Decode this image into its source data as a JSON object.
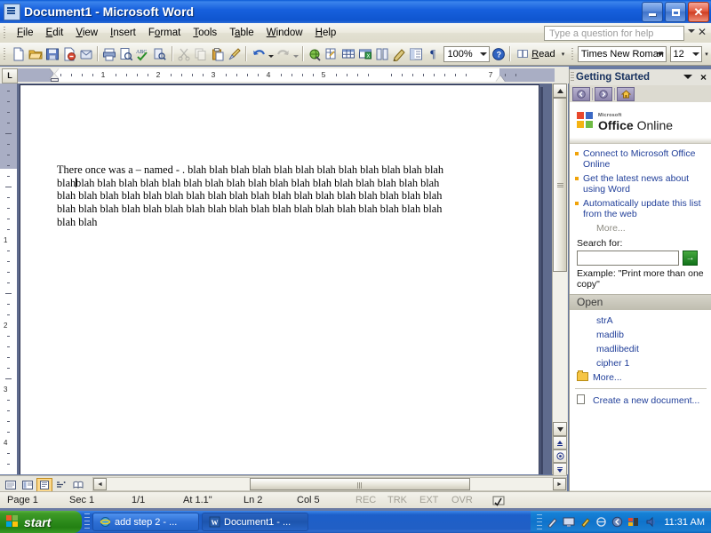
{
  "window": {
    "title": "Document1 - Microsoft Word",
    "app_icon": "word-document-icon",
    "minimize_label": "Minimize",
    "restore_label": "Restore",
    "close_label": "Close"
  },
  "menubar": {
    "items": [
      {
        "label": "File",
        "accel": "F"
      },
      {
        "label": "Edit",
        "accel": "E"
      },
      {
        "label": "View",
        "accel": "V"
      },
      {
        "label": "Insert",
        "accel": "I"
      },
      {
        "label": "Format",
        "accel": "o"
      },
      {
        "label": "Tools",
        "accel": "T"
      },
      {
        "label": "Table",
        "accel": "a"
      },
      {
        "label": "Window",
        "accel": "W"
      },
      {
        "label": "Help",
        "accel": "H"
      }
    ],
    "ask_placeholder": "Type a question for help"
  },
  "toolbar": {
    "buttons": [
      "new-document-icon",
      "open-folder-icon",
      "save-icon",
      "permission-icon",
      "email-icon",
      "print-icon",
      "print-preview-icon",
      "spelling-check-icon",
      "research-icon",
      "cut-icon",
      "copy-icon",
      "paste-icon",
      "format-painter-icon",
      "undo-icon",
      "redo-icon",
      "insert-hyperlink-icon",
      "tables-borders-icon",
      "insert-table-icon",
      "insert-excel-sheet-icon",
      "columns-icon",
      "drawing-icon",
      "document-map-icon",
      "show-hide-paragraph-icon"
    ],
    "zoom_value": "100%",
    "help_icon": "help-icon",
    "read_label": "Read",
    "read_icon": "read-layout-icon",
    "font_name": "Times New Roman",
    "font_size": "12",
    "overflow_label": "Toolbar Options"
  },
  "ruler": {
    "tab_selector": "L",
    "horizontal_numbers": [
      "1",
      "2",
      "3",
      "4",
      "5",
      "7"
    ],
    "vertical_numbers": [
      "1",
      "2",
      "3",
      "4"
    ]
  },
  "document": {
    "paragraph": "There once was a – named - . blah blah blah blah blah blah blah blah blah blah blah blah blah blah blah blah blah blah blah blah blah blah blah blah blah blah blah blah blah blah blah blah blah blah blah blah blah blah blah blah blah blah blah blah blah blah blah blah blah blah blah blah blah blah blah blah blah blah blah blah blah blah blah blah blah blah blah blah",
    "text_before_caret": "There once was a – named - . blah blah blah blah blah blah blah blah blah blah blah blah blah",
    "text_after_caret": "blah blah blah blah blah blah blah blah blah blah blah blah blah blah blah blah blah blah blah blah blah blah blah blah blah blah blah blah blah blah blah blah blah blah blah blah blah blah blah blah blah blah blah blah blah blah blah blah blah blah blah blah blah blah blah"
  },
  "doc_scroll": {
    "up_arrow": "▲",
    "down_arrow": "▼",
    "select_browse_object": "select-browse-object-icon",
    "prev_page": "previous-page-icon",
    "next_page": "next-page-icon",
    "left_arrow": "◄",
    "right_arrow": "►"
  },
  "view_buttons": [
    {
      "name": "normal-view",
      "glyph": "▤",
      "active": false
    },
    {
      "name": "web-layout-view",
      "glyph": "▦",
      "active": false
    },
    {
      "name": "print-layout-view",
      "glyph": "▣",
      "active": true
    },
    {
      "name": "outline-view",
      "glyph": "▥",
      "active": false
    },
    {
      "name": "reading-layout-view",
      "glyph": "▧",
      "active": false
    },
    {
      "name": "scroll-left",
      "glyph": "‹",
      "active": false
    }
  ],
  "taskpane": {
    "title": "Getting Started",
    "close_label": "×",
    "nav": {
      "back": "back-icon",
      "forward": "forward-icon",
      "home": "home-icon"
    },
    "logo": {
      "ms": "Microsoft",
      "office": "Office",
      "online": "Online"
    },
    "links": [
      "Connect to Microsoft Office Online",
      "Get the latest news about using Word",
      "Automatically update this list from the web"
    ],
    "more_label": "More...",
    "search_label": "Search for:",
    "search_value": "",
    "go_label": "→",
    "example_text": "Example: \"Print more than one copy\"",
    "open_section": "Open",
    "open_files": [
      "strA",
      "madlib",
      "madlibedit",
      "cipher 1"
    ],
    "open_more": "More...",
    "create_new": "Create a new document..."
  },
  "statusbar": {
    "page": "Page 1",
    "section": "Sec 1",
    "pages": "1/1",
    "at": "At 1.1\"",
    "line": "Ln 2",
    "column": "Col 5",
    "rec": "REC",
    "trk": "TRK",
    "ext": "EXT",
    "ovr": "OVR",
    "language_icon": "spelling-status-icon"
  },
  "taskbar": {
    "start_label": "start",
    "items": [
      {
        "label": "add step 2 - ...",
        "icon": "internet-explorer-icon",
        "active": false
      },
      {
        "label": "Document1 - ...",
        "icon": "word-icon",
        "active": true
      }
    ],
    "tray_icons": [
      "pen-icon",
      "display-icon",
      "marker-icon",
      "network-icon",
      "shield-icon",
      "office-icon",
      "volume-icon"
    ],
    "clock": "11:31 AM"
  }
}
